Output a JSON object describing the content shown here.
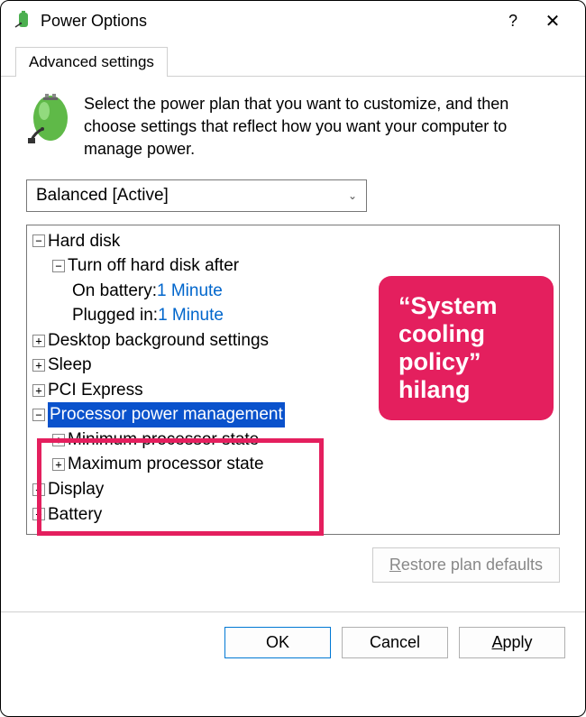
{
  "title": "Power Options",
  "tab": "Advanced settings",
  "description": "Select the power plan that you want to customize, and then choose settings that reflect how you want your computer to manage power.",
  "plan_selected": "Balanced [Active]",
  "tree": {
    "hard_disk": "Hard disk",
    "turn_off": "Turn off hard disk after",
    "on_battery_label": "On battery: ",
    "on_battery_value": "1 Minute",
    "plugged_in_label": "Plugged in: ",
    "plugged_in_value": "1 Minute",
    "desktop_bg": "Desktop background settings",
    "sleep": "Sleep",
    "pci": "PCI Express",
    "proc": "Processor power management",
    "min_proc": "Minimum processor state",
    "max_proc": "Maximum processor state",
    "display": "Display",
    "battery": "Battery"
  },
  "callout": "\"System cooling policy\" hilang",
  "restore": "Restore plan defaults",
  "buttons": {
    "ok": "OK",
    "cancel": "Cancel",
    "apply": "Apply"
  }
}
